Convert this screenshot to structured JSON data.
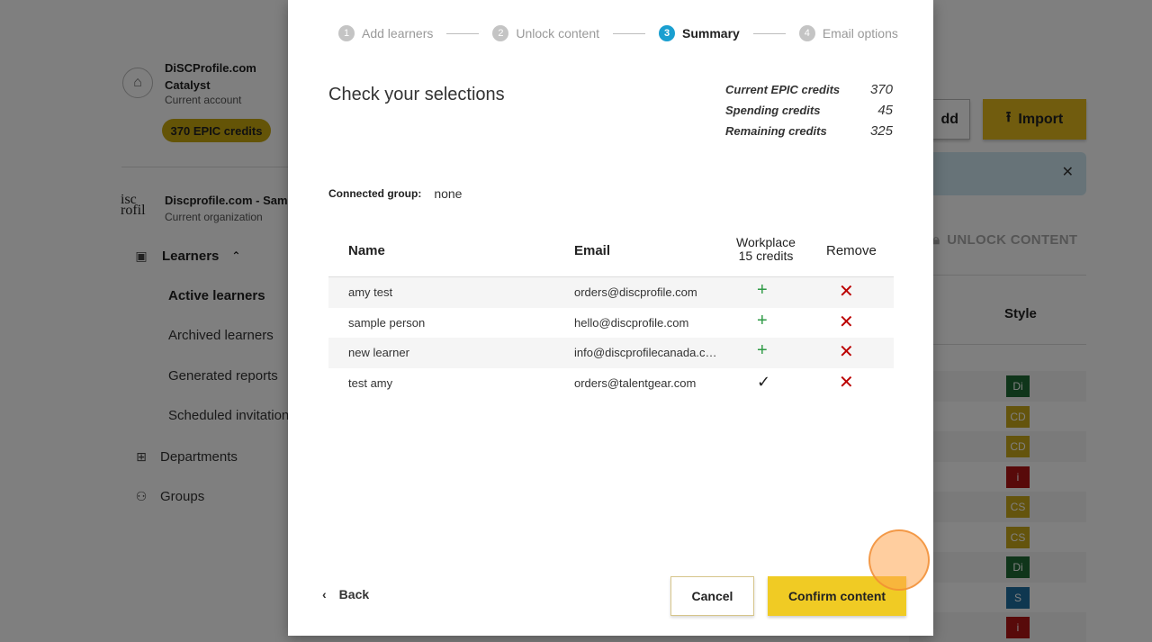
{
  "background": {
    "account": {
      "name": "DiSCProfile.com Catalyst",
      "sub": "Current account",
      "credits_pill": "370 EPIC credits"
    },
    "org": {
      "logo": "disc profile",
      "name": "Discprofile.com - Samp",
      "sub": "Current organization"
    },
    "nav": {
      "learners": "Learners",
      "active": "Active learners",
      "archived": "Archived learners",
      "reports": "Generated reports",
      "scheduled": "Scheduled invitation",
      "departments": "Departments",
      "groups": "Groups"
    },
    "add_button": "dd",
    "import_button": "Import",
    "unlock_button": "UNLOCK CONTENT",
    "style_header": "Style",
    "styles": [
      {
        "label": "Di",
        "color": "#1e6b34"
      },
      {
        "label": "CD",
        "color": "#c9a81a"
      },
      {
        "label": "CD",
        "color": "#c9a81a"
      },
      {
        "label": "i",
        "color": "#b01414"
      },
      {
        "label": "CS",
        "color": "#c9a81a"
      },
      {
        "label": "CS",
        "color": "#c9a81a"
      },
      {
        "label": "Di",
        "color": "#1e6b34"
      },
      {
        "label": "S",
        "color": "#1f6fa0"
      },
      {
        "label": "i",
        "color": "#b01414"
      }
    ]
  },
  "modal": {
    "steps": [
      {
        "num": "1",
        "label": "Add learners"
      },
      {
        "num": "2",
        "label": "Unlock content"
      },
      {
        "num": "3",
        "label": "Summary"
      },
      {
        "num": "4",
        "label": "Email options"
      }
    ],
    "title": "Check your selections",
    "credits": [
      {
        "label": "Current EPIC credits",
        "value": "370"
      },
      {
        "label": "Spending credits",
        "value": "45"
      },
      {
        "label": "Remaining credits",
        "value": "325"
      }
    ],
    "connected_group_label": "Connected group:",
    "connected_group_value": "none",
    "table": {
      "headers": {
        "name": "Name",
        "email": "Email",
        "workplace": "Workplace",
        "workplace_credits": "15 credits",
        "remove": "Remove"
      },
      "rows": [
        {
          "name": "amy test",
          "email": "orders@discprofile.com",
          "status": "plus"
        },
        {
          "name": "sample person",
          "email": "hello@discprofile.com",
          "status": "plus"
        },
        {
          "name": "new learner",
          "email": "info@discprofilecanada.c…",
          "status": "plus"
        },
        {
          "name": "test amy",
          "email": "orders@talentgear.com",
          "status": "check"
        }
      ]
    },
    "back": "Back",
    "cancel": "Cancel",
    "confirm": "Confirm content"
  }
}
